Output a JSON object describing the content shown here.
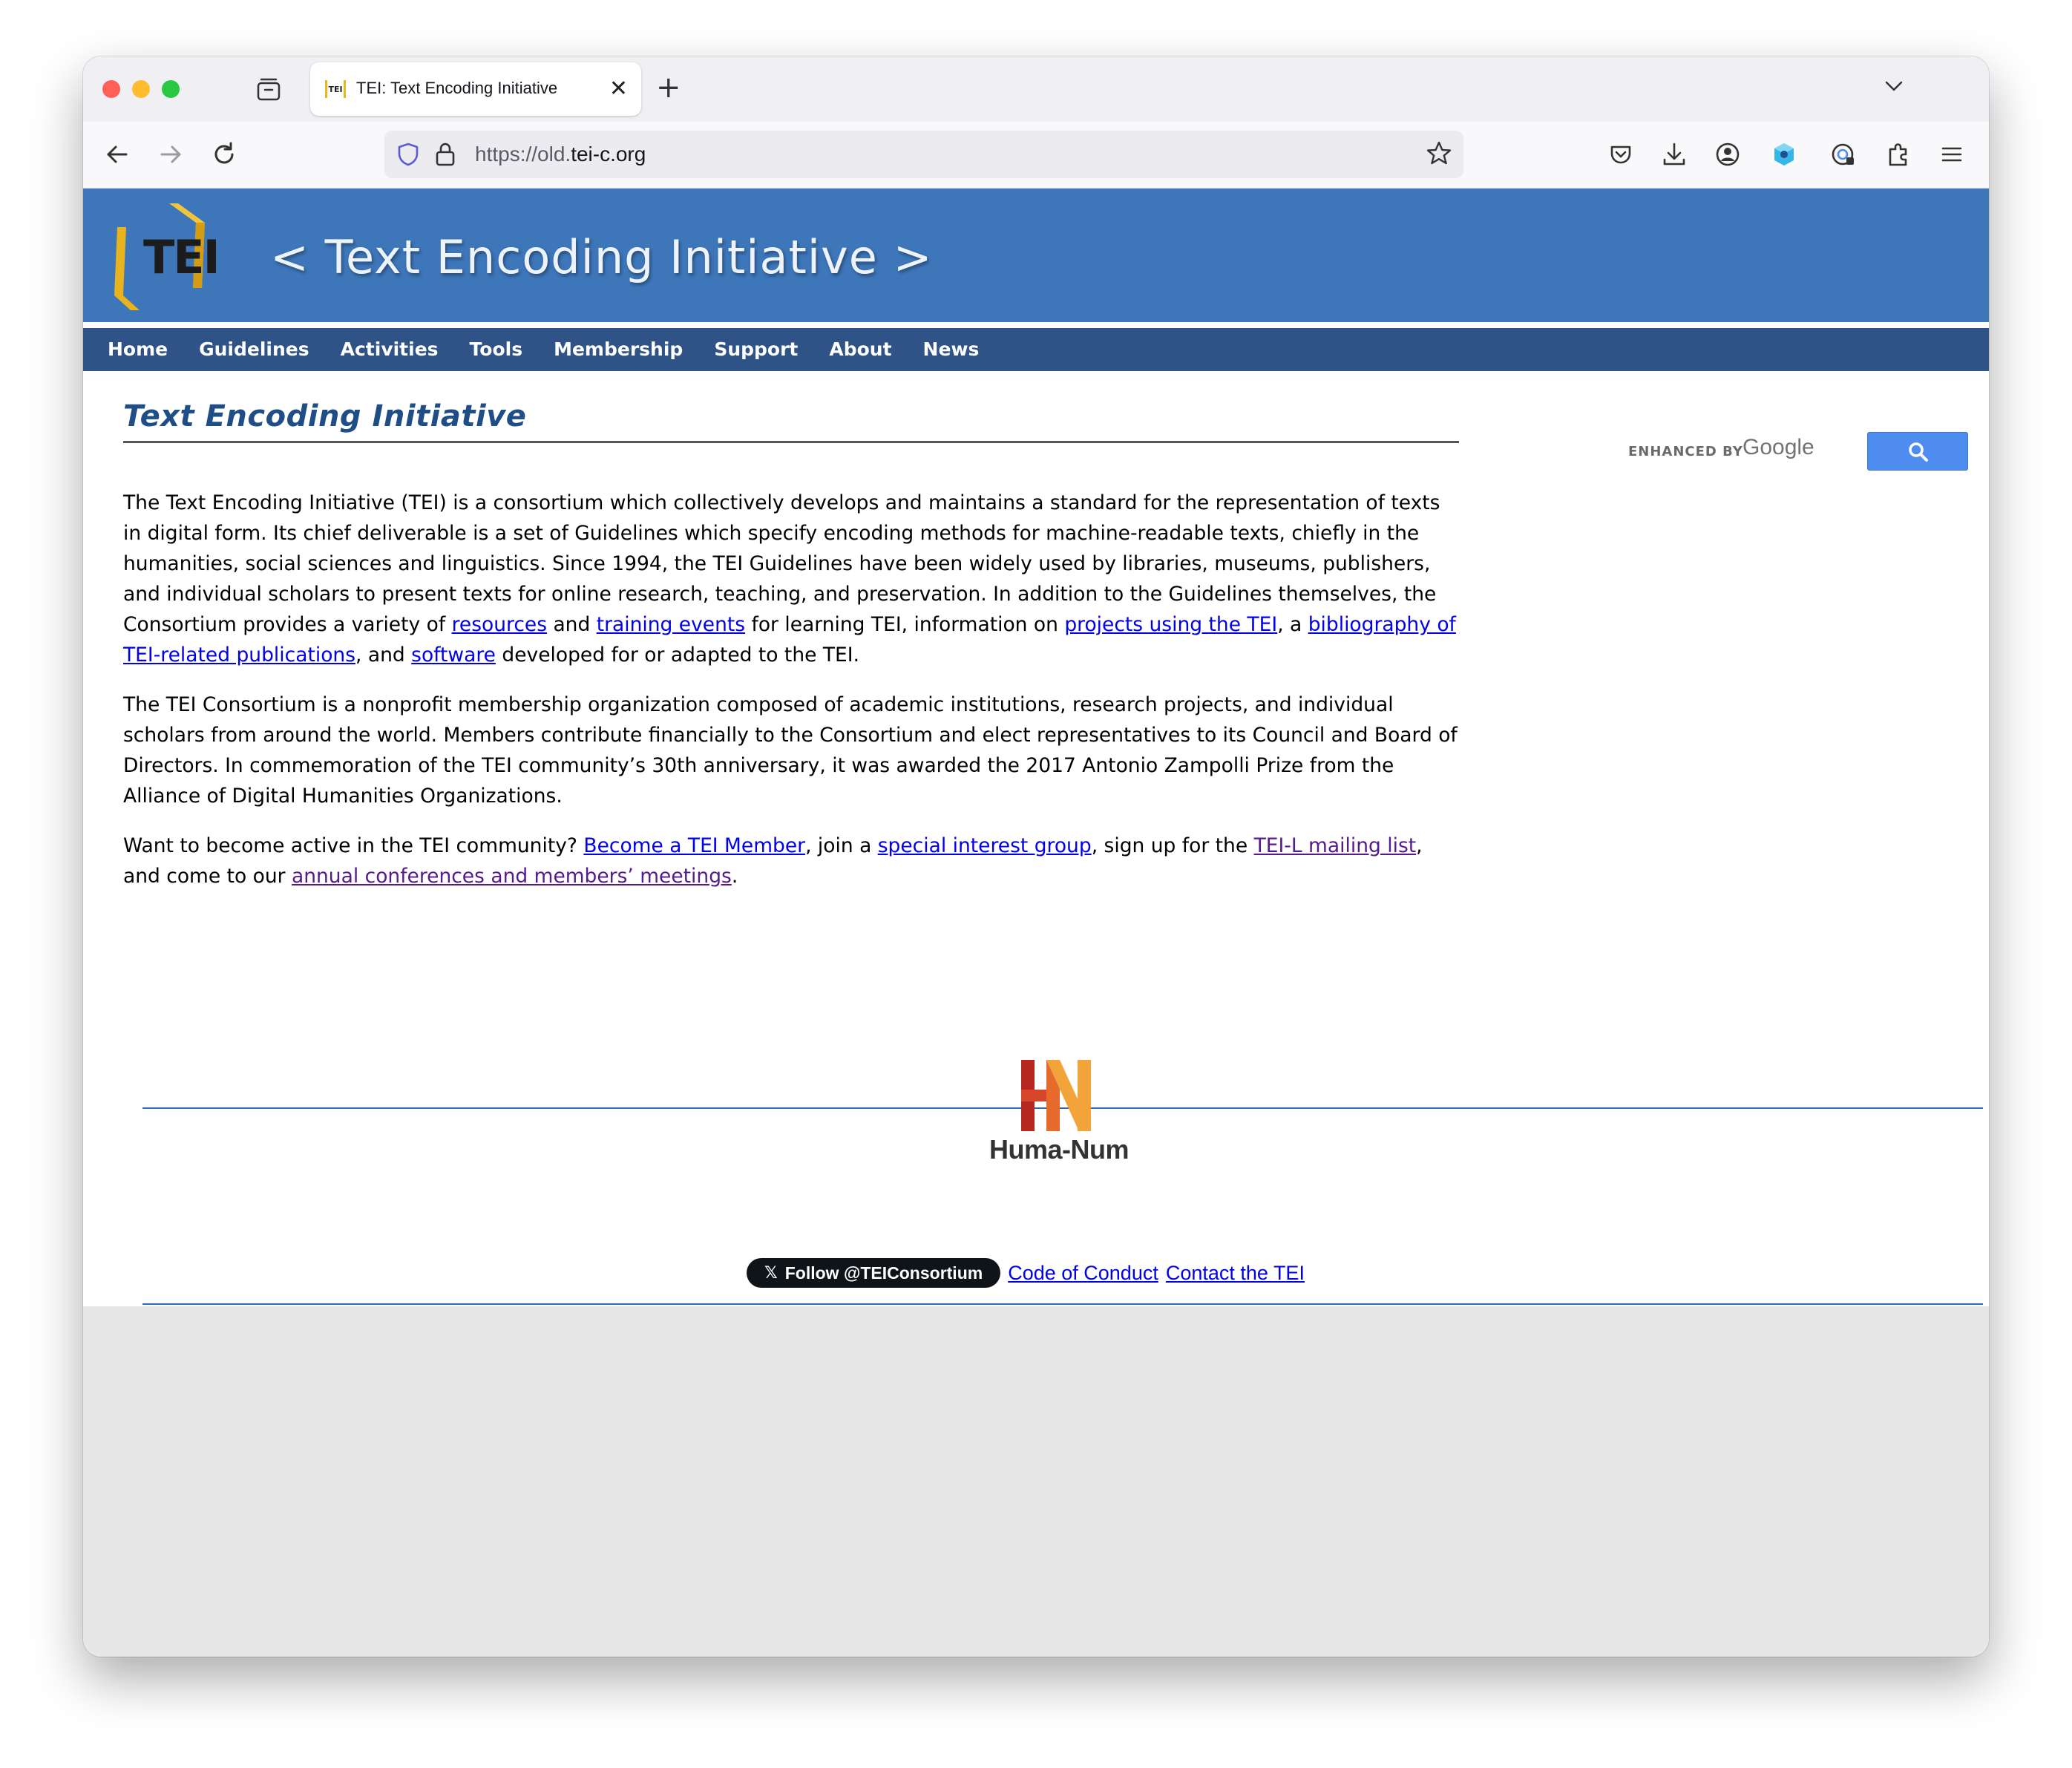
{
  "browser": {
    "tab_title": "TEI: Text Encoding Initiative",
    "tab_favicon_text": "TEI",
    "tab_close": "✕",
    "new_tab": "+",
    "url_prefix": "https://old.",
    "url_host": "tei-c.org"
  },
  "site": {
    "logo_text": "TEI",
    "title": "< Text Encoding Initiative >",
    "nav": [
      "Home",
      "Guidelines",
      "Activities",
      "Tools",
      "Membership",
      "Support",
      "About",
      "News"
    ]
  },
  "search": {
    "enhanced_by": "ENHANCED BY",
    "google": "Google"
  },
  "content": {
    "heading": "Text Encoding Initiative",
    "p1": {
      "t1": "The Text Encoding Initiative (TEI) is a consortium which collectively develops and maintains a standard for the representation of texts in digital form. Its chief deliverable is a set of Guidelines which specify encoding methods for machine-readable texts, chiefly in the humanities, social sciences and linguistics. Since 1994, the TEI Guidelines have been widely used by libraries, museums, publishers, and individual scholars to present texts for online research, teaching, and preservation. In addition to the Guidelines themselves, the Consortium provides a variety of ",
      "l1": "resources",
      "t2": " and ",
      "l2": "training events",
      "t3": " for learning TEI, information on ",
      "l3": "projects using the TEI",
      "t4": ", a ",
      "l4": "bibliography of TEI-related publications",
      "t5": ", and ",
      "l5": "software",
      "t6": " developed for or adapted to the TEI."
    },
    "p2": "The TEI Consortium is a nonprofit membership organization composed of academic institutions, research projects, and individual scholars from around the world. Members contribute financially to the Consortium and elect representatives to its Council and Board of Directors. In commemoration of the TEI community’s 30th anniversary, it was awarded the 2017 Antonio Zampolli Prize from the Alliance of Digital Humanities Organizations.",
    "p3": {
      "t1": "Want to become active in the TEI community? ",
      "l1": "Become a TEI Member",
      "t2": ", join a ",
      "l2": "special interest group",
      "t3": ", sign up for the ",
      "l3": "TEI-L mailing list",
      "t4": ", and come to our ",
      "l4": "annual conferences and members’ meetings",
      "t5": "."
    }
  },
  "footer": {
    "humanum_text": "Huma-Num",
    "x_logo": "𝕏",
    "follow": "Follow @TEIConsortium",
    "code_of_conduct": "Code of Conduct",
    "contact": "Contact the TEI"
  },
  "colors": {
    "banner": "#3d76b9",
    "navbar": "#2f5386",
    "heading": "#1f4e86",
    "link": "#0000ee",
    "visited_link": "#551a8b",
    "humanum_red": "#b5271f",
    "humanum_orange": "#f2a33a"
  }
}
